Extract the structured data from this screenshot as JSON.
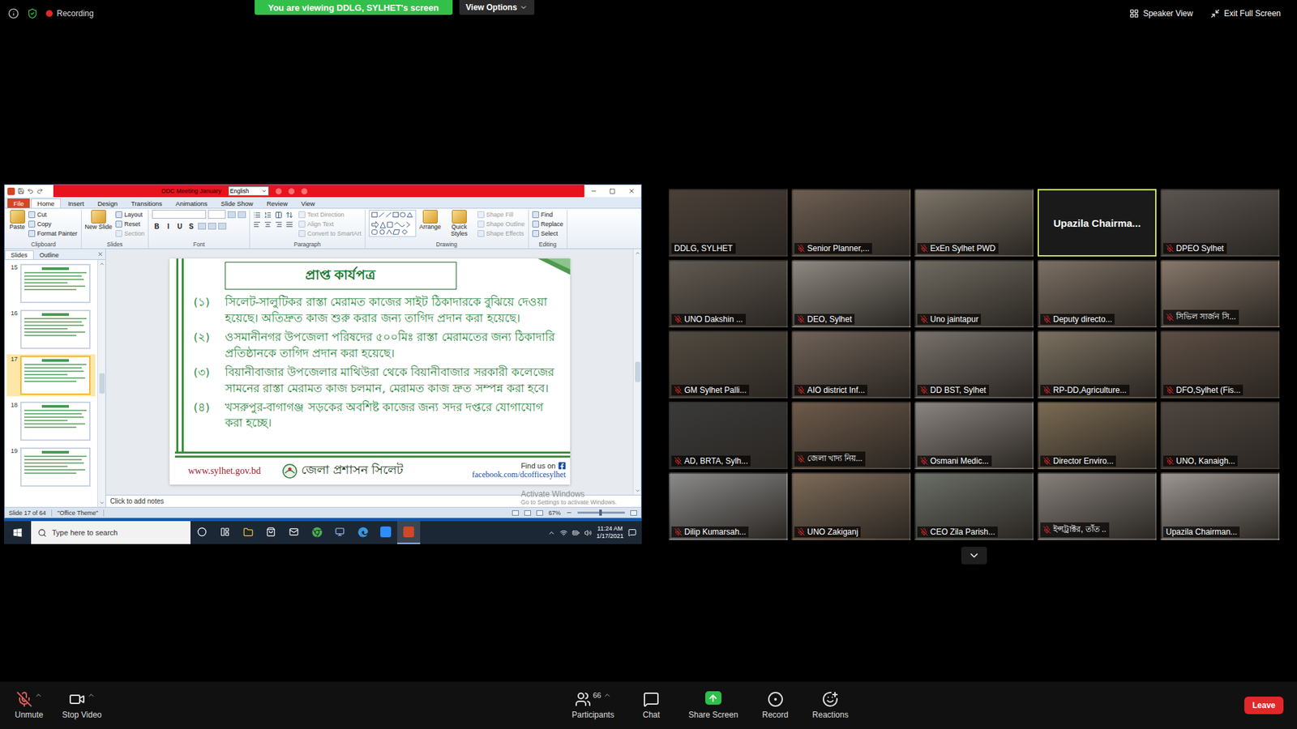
{
  "top_bar": {
    "recording": "Recording",
    "banner": "You are viewing DDLG, SYLHET's screen",
    "view_options": "View Options",
    "speaker_view": "Speaker View",
    "exit_full_screen": "Exit Full Screen"
  },
  "powerpoint": {
    "title": "DDC Meeting January",
    "language": "English",
    "tabs": [
      {
        "label": "File",
        "selected": false,
        "kind": "file"
      },
      {
        "label": "Home",
        "selected": true,
        "kind": "tab"
      },
      {
        "label": "Insert",
        "selected": false,
        "kind": "tab"
      },
      {
        "label": "Design",
        "selected": false,
        "kind": "tab"
      },
      {
        "label": "Transitions",
        "selected": false,
        "kind": "tab"
      },
      {
        "label": "Animations",
        "selected": false,
        "kind": "tab"
      },
      {
        "label": "Slide Show",
        "selected": false,
        "kind": "tab"
      },
      {
        "label": "Review",
        "selected": false,
        "kind": "tab"
      },
      {
        "label": "View",
        "selected": false,
        "kind": "tab"
      }
    ],
    "ribbon": [
      {
        "label": "Clipboard",
        "kind": "plain",
        "items": [
          {
            "label": "Paste",
            "kind": "large",
            "disabled": false
          },
          {
            "label": "Cut",
            "kind": "small",
            "disabled": false
          },
          {
            "label": "Copy",
            "kind": "small",
            "disabled": false
          },
          {
            "label": "Format Painter",
            "kind": "small",
            "disabled": false
          }
        ]
      },
      {
        "label": "Slides",
        "kind": "plain",
        "items": [
          {
            "label": "New Slide",
            "kind": "large",
            "disabled": false
          },
          {
            "label": "Layout",
            "kind": "small",
            "disabled": false
          },
          {
            "label": "Reset",
            "kind": "small",
            "disabled": false
          },
          {
            "label": "Section",
            "kind": "small",
            "disabled": true
          }
        ]
      },
      {
        "label": "Font",
        "kind": "font",
        "items": [
          {
            "label": "B",
            "kind": "toggle",
            "disabled": false
          },
          {
            "label": "I",
            "kind": "toggle",
            "disabled": false
          },
          {
            "label": "U",
            "kind": "toggle",
            "disabled": false
          },
          {
            "label": "S",
            "kind": "toggle",
            "disabled": false
          }
        ]
      },
      {
        "label": "Paragraph",
        "kind": "paragraph",
        "items": [
          {
            "label": "Text Direction",
            "kind": "small",
            "disabled": true
          },
          {
            "label": "Align Text",
            "kind": "small",
            "disabled": true
          },
          {
            "label": "Convert to SmartArt",
            "kind": "small",
            "disabled": true
          }
        ]
      },
      {
        "label": "Drawing",
        "kind": "drawing",
        "items": [
          {
            "label": "Arrange",
            "kind": "large",
            "disabled": false
          },
          {
            "label": "Quick Styles",
            "kind": "large",
            "disabled": false
          },
          {
            "label": "Shape Fill",
            "kind": "small",
            "disabled": true
          },
          {
            "label": "Shape Outline",
            "kind": "small",
            "disabled": true
          },
          {
            "label": "Shape Effects",
            "kind": "small",
            "disabled": true
          }
        ]
      },
      {
        "label": "Editing",
        "kind": "plain",
        "items": [
          {
            "label": "Find",
            "kind": "small",
            "disabled": false
          },
          {
            "label": "Replace",
            "kind": "small",
            "disabled": false
          },
          {
            "label": "Select",
            "kind": "small",
            "disabled": false
          }
        ]
      }
    ],
    "pane_tabs": [
      {
        "label": "Slides",
        "selected": true
      },
      {
        "label": "Outline",
        "selected": false
      }
    ],
    "thumbnails": [
      {
        "number": "15",
        "selected": false
      },
      {
        "number": "16",
        "selected": false
      },
      {
        "number": "17",
        "selected": true
      },
      {
        "number": "18",
        "selected": false
      },
      {
        "number": "19",
        "selected": false
      }
    ],
    "slide": {
      "title": "প্রাপ্ত কার্যপত্র",
      "items": [
        {
          "number": "(১)",
          "text": "সিলেট-সালুটিকর রাস্তা মেরামত কাজের সাইট ঠিকাদারকে বুঝিয়ে দেওয়া হয়েছে। অতিদ্রুত কাজ শুরু করার জন্য তাগিদ প্রদান করা হয়েছে।"
        },
        {
          "number": "(২)",
          "text": "ওসমানীনগর উপজেলা পরিষদের ৫০০মিঃ রাস্তা মেরামতের জন্য ঠিকাদারি প্রতিষ্ঠানকে তাগিদ প্রদান করা হয়েছে।"
        },
        {
          "number": "(৩)",
          "text": "বিয়ানীবাজার উপজেলার মাথিউরা থেকে বিয়ানীবাজার সরকারী কলেজের সামনের রাস্তা মেরামত কাজ চলমান, মেরামত কাজ দ্রুত সম্পন্ন করা হবে।"
        },
        {
          "number": "(৪)",
          "text": "খসরুপুর-বাগাগঞ্জ সড়কের অবশিষ্ট কাজের জন্য সদর দপ্তরে যোগাযোগ করা হচ্ছে।"
        }
      ],
      "footer": {
        "url": "www.sylhet.gov.bd",
        "org": "জেলা প্রশাসন সিলেট",
        "find_us": "Find us on",
        "facebook": "facebook.com/dcofficesylhet"
      }
    },
    "notes_placeholder": "Click to add notes",
    "watermark": {
      "title": "Activate Windows",
      "subtitle": "Go to Settings to activate Windows."
    },
    "status_bar": {
      "slide": "Slide 17 of 64",
      "theme": "\"Office Theme\"",
      "zoom": "67%",
      "zoom_level": 0.45
    }
  },
  "taskbar": {
    "search_placeholder": "Type here to search",
    "time": "11:24 AM",
    "date": "1/17/2021"
  },
  "gallery": [
    {
      "name": "DDLG, SYLHET",
      "muted": false,
      "video": true,
      "speaking": false
    },
    {
      "name": "Senior Planner,...",
      "muted": true,
      "video": true,
      "speaking": false
    },
    {
      "name": "ExEn Sylhet PWD",
      "muted": true,
      "video": true,
      "speaking": false
    },
    {
      "name": "Upazila Chairma...",
      "muted": false,
      "video": false,
      "speaking": true
    },
    {
      "name": "DPEO Sylhet",
      "muted": true,
      "video": true,
      "speaking": false
    },
    {
      "name": "UNO Dakshin ...",
      "muted": true,
      "video": true,
      "speaking": false
    },
    {
      "name": "DEO, Sylhet",
      "muted": true,
      "video": true,
      "speaking": false
    },
    {
      "name": "Uno jaintapur",
      "muted": true,
      "video": true,
      "speaking": false
    },
    {
      "name": "Deputy directo...",
      "muted": true,
      "video": true,
      "speaking": false
    },
    {
      "name": "সিভিল সার্জন সি...",
      "muted": true,
      "video": true,
      "speaking": false
    },
    {
      "name": "GM Sylhet Palli...",
      "muted": true,
      "video": true,
      "speaking": false
    },
    {
      "name": "AIO district Inf...",
      "muted": true,
      "video": true,
      "speaking": false
    },
    {
      "name": "DD BST, Sylhet",
      "muted": true,
      "video": true,
      "speaking": false
    },
    {
      "name": "RP-DD,Agriculture...",
      "muted": true,
      "video": true,
      "speaking": false
    },
    {
      "name": "DFO,Sylhet (Fis...",
      "muted": true,
      "video": true,
      "speaking": false
    },
    {
      "name": "AD, BRTA, Sylh...",
      "muted": true,
      "video": true,
      "speaking": false
    },
    {
      "name": "জেলা খাদ্য নিয়...",
      "muted": true,
      "video": true,
      "speaking": false
    },
    {
      "name": "Osmani Medic...",
      "muted": true,
      "video": true,
      "speaking": false
    },
    {
      "name": "Director Enviro...",
      "muted": true,
      "video": true,
      "speaking": false
    },
    {
      "name": "UNO, Kanaigh...",
      "muted": true,
      "video": true,
      "speaking": false
    },
    {
      "name": "Dilip Kumarsah...",
      "muted": true,
      "video": true,
      "speaking": false
    },
    {
      "name": "UNO Zakiganj",
      "muted": true,
      "video": true,
      "speaking": false
    },
    {
      "name": "CEO Zila Parish...",
      "muted": true,
      "video": true,
      "speaking": false
    },
    {
      "name": "ইন্সট্রাক্টর, তাঁত ..",
      "muted": true,
      "video": true,
      "speaking": false
    },
    {
      "name": "Upazila Chairman...",
      "muted": false,
      "video": true,
      "speaking": false
    }
  ],
  "toolbar": {
    "left": [
      {
        "label": "Unmute",
        "kind": "mic",
        "caret": true
      },
      {
        "label": "Stop Video",
        "kind": "video",
        "caret": true
      }
    ],
    "center": [
      {
        "label": "Participants",
        "kind": "participants",
        "caret": true,
        "badge": "66"
      },
      {
        "label": "Chat",
        "kind": "chat",
        "caret": false
      },
      {
        "label": "Share Screen",
        "kind": "share",
        "caret": false
      },
      {
        "label": "Record",
        "kind": "record",
        "caret": false
      },
      {
        "label": "Reactions",
        "kind": "reactions",
        "caret": false
      }
    ],
    "leave": "Leave"
  }
}
